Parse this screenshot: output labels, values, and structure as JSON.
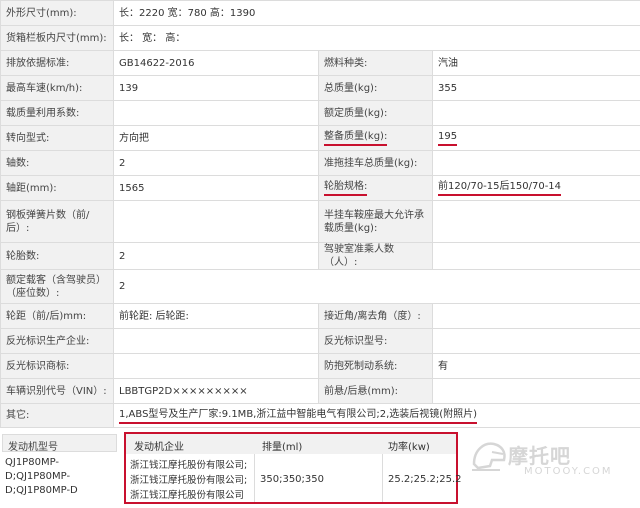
{
  "rows": [
    {
      "l1": "外形尺寸(mm):",
      "v1": "长：2220 宽：780 高：1390"
    },
    {
      "l1": "货箱栏板内尺寸(mm):",
      "v1": "长： 宽： 高："
    },
    {
      "l1": "排放依据标准:",
      "v1": "GB14622-2016",
      "l2": "燃料种类:",
      "v2": "汽油"
    },
    {
      "l1": "最高车速(km/h):",
      "v1": "139",
      "l2": "总质量(kg):",
      "v2": "355"
    },
    {
      "l1": "载质量利用系数:",
      "v1": "",
      "l2": "额定质量(kg):",
      "v2": ""
    },
    {
      "l1": "转向型式:",
      "v1": "方向把",
      "l2": "整备质量(kg):",
      "v2": "195"
    },
    {
      "l1": "轴数:",
      "v1": "2",
      "l2": "准拖挂车总质量(kg):",
      "v2": ""
    },
    {
      "l1": "轴距(mm):",
      "v1": "1565",
      "l2": "轮胎规格:",
      "v2": "前120/70-15后150/70-14"
    },
    {
      "l1": "钢板弹簧片数（前/后）:",
      "v1": "",
      "l2": "半挂车鞍座最大允许承载质量(kg):",
      "v2": ""
    },
    {
      "l1": "轮胎数:",
      "v1": "2",
      "l2": "驾驶室准乘人数（人）:",
      "v2": ""
    },
    {
      "l1": "额定载客（含驾驶员）（座位数）:",
      "v1": "2"
    },
    {
      "l1": "轮距（前/后)mm:",
      "v1": "前轮距: 后轮距:",
      "l2": "接近角/离去角（度）:",
      "v2": ""
    },
    {
      "l1": "反光标识生产企业:",
      "v1": "",
      "l2": "反光标识型号:",
      "v2": ""
    },
    {
      "l1": "反光标识商标:",
      "v1": "",
      "l2": "防抱死制动系统:",
      "v2": "有"
    },
    {
      "l1": "车辆识别代号（VIN）:",
      "v1": "LBBTGP2D×××××××××",
      "l2": "前悬/后悬(mm):",
      "v2": ""
    },
    {
      "l1": "其它:",
      "v1": "1,ABS型号及生产厂家:9.1MB,浙江益中智能电气有限公司;2,选装后视镜(附照片)"
    }
  ],
  "engine": {
    "label": "发动机型号",
    "models": [
      "QJ1P80MP-D;QJ1P80MP-",
      "D;QJ1P80MP-D"
    ],
    "headers": {
      "company": "发动机企业",
      "displacement": "排量(ml)",
      "power": "功率(kw)"
    },
    "companies": [
      "浙江钱江摩托股份有限公司;",
      "浙江钱江摩托股份有限公司;",
      "浙江钱江摩托股份有限公司"
    ],
    "displacement": "350;350;350",
    "power": "25.2;25.2;25.2"
  },
  "watermark": {
    "cn": "摩托吧",
    "en": "MOTOOY.COM"
  },
  "colors": {
    "accent_red": "#c8102e",
    "label_bg": "#f1f1f1",
    "border": "#dcdcdc"
  }
}
